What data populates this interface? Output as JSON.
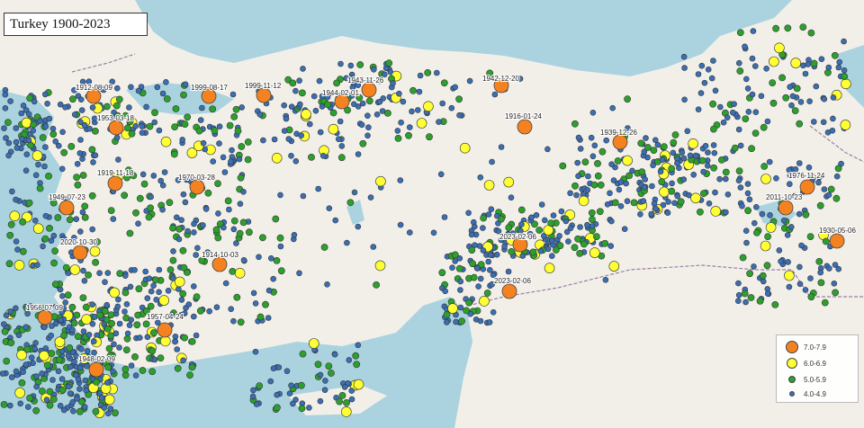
{
  "title": "Turkey 1900-2023",
  "colors": {
    "sea": "#aad3df",
    "land": "#f2efe9",
    "m7": "#f58220",
    "m6": "#ffff33",
    "m5": "#2ca02c",
    "m4": "#3a6fb5"
  },
  "legend": [
    {
      "label": "7.0-7.9",
      "class": "m7"
    },
    {
      "label": "6.0-6.9",
      "class": "m6"
    },
    {
      "label": "5.0-5.9",
      "class": "m5"
    },
    {
      "label": "4.0-4.9",
      "class": "m4"
    }
  ],
  "major_quakes": [
    {
      "date": "1912-08-09"
    },
    {
      "date": "1999-08-17"
    },
    {
      "date": "1999-11-12"
    },
    {
      "date": "1943-11-26"
    },
    {
      "date": "1944-02-01"
    },
    {
      "date": "1942-12-20"
    },
    {
      "date": "1953-03-18"
    },
    {
      "date": "1916-01-24"
    },
    {
      "date": "1939-12-26"
    },
    {
      "date": "1919-11-18"
    },
    {
      "date": "1970-03-28"
    },
    {
      "date": "1976-11-24"
    },
    {
      "date": "1949-07-23"
    },
    {
      "date": "2011-10-23"
    },
    {
      "date": "1930-05-06"
    },
    {
      "date": "2020-10-30"
    },
    {
      "date": "2023-02-06"
    },
    {
      "date": "1914-10-03"
    },
    {
      "date": "2023-02-06"
    },
    {
      "date": "1956-07-09"
    },
    {
      "date": "1957-04-24"
    },
    {
      "date": "1948-02-09"
    }
  ]
}
